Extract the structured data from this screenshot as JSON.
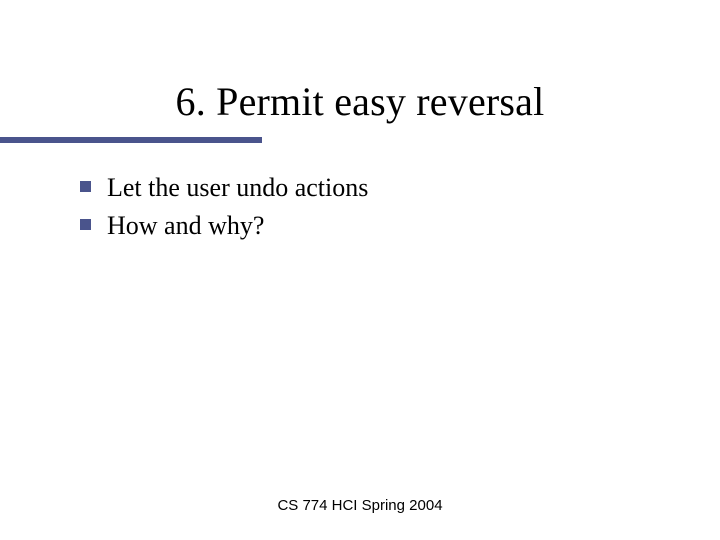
{
  "title": "6. Permit easy reversal",
  "bullets": [
    "Let the user undo actions",
    "How and why?"
  ],
  "footer": "CS 774 HCI Spring 2004"
}
